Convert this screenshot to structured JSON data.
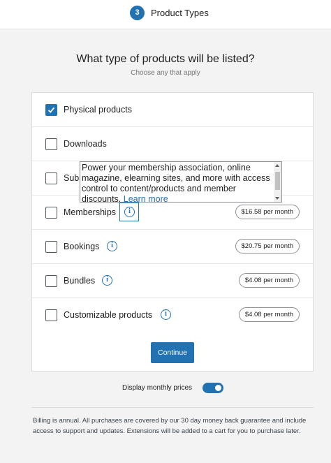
{
  "header": {
    "step_number": "3",
    "step_title": "Product Types"
  },
  "main": {
    "question": "What type of products will be listed?",
    "subtitle": "Choose any that apply"
  },
  "products": [
    {
      "label": "Physical products",
      "checked": true
    },
    {
      "label": "Downloads",
      "checked": false
    },
    {
      "label": "Subs",
      "checked": false
    },
    {
      "label": "Memberships",
      "checked": false,
      "price": "$16.58 per month",
      "info_icon": "info-icon"
    },
    {
      "label": "Bookings",
      "checked": false,
      "price": "$20.75 per month",
      "info_icon": "info-icon"
    },
    {
      "label": "Bundles",
      "checked": false,
      "price": "$4.08 per month",
      "info_icon": "info-icon"
    },
    {
      "label": "Customizable products",
      "checked": false,
      "price": "$4.08 per month",
      "info_icon": "info-icon"
    }
  ],
  "tooltip": {
    "text": "Power your membership association, online magazine, elearning sites, and more with access control to content/products and member discounts.",
    "link": "Learn more"
  },
  "continue_label": "Continue",
  "toggle": {
    "label": "Display monthly prices",
    "on": true
  },
  "billing_note": "Billing is annual. All purchases are covered by our 30 day money back guarantee and include access to support and updates. Extensions will be added to a cart for you to purchase later.",
  "colors": {
    "accent": "#2271b1",
    "background": "#f3f3f3"
  }
}
